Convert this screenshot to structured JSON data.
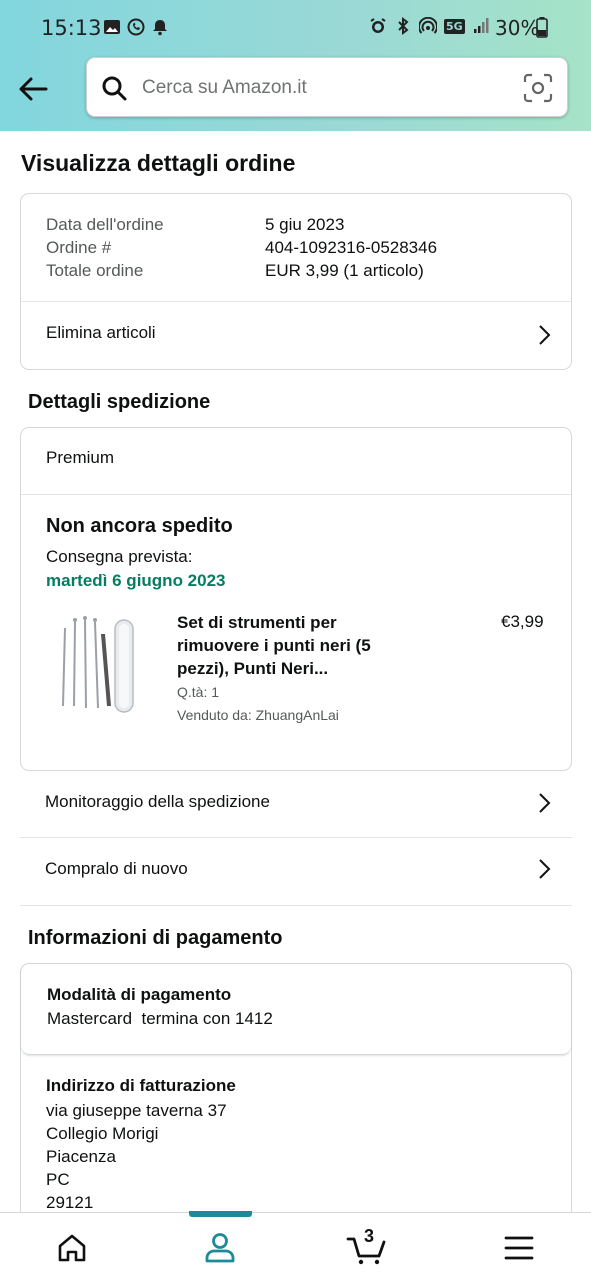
{
  "status_bar": {
    "time": "15:13",
    "battery": "30%",
    "network": "5G"
  },
  "search": {
    "placeholder": "Cerca su Amazon.it"
  },
  "page_title": "Visualizza dettagli ordine",
  "order_summary": {
    "rows": [
      {
        "label": "Data dell'ordine",
        "value": "5 giu 2023"
      },
      {
        "label": "Ordine #",
        "value": "404-1092316-0528346"
      },
      {
        "label": "Totale ordine",
        "value": "EUR 3,99 (1 articolo)"
      }
    ],
    "delete_items": "Elimina articoli"
  },
  "shipping": {
    "section_title": "Dettagli spedizione",
    "service": "Premium",
    "status": "Non ancora spedito",
    "delivery_label": "Consegna prevista:",
    "delivery_date": "martedì 6 giugno 2023",
    "item": {
      "title_line1": "Set di strumenti per",
      "title_line2": "rimuovere i punti neri (5",
      "title_line3": "pezzi), Punti Neri...",
      "price": "€3,99",
      "qty": "Q.tà: 1",
      "seller": "Venduto da: ZhuangAnLai"
    },
    "track": "Monitoraggio della spedizione",
    "buy_again": "Compralo di nuovo"
  },
  "payment": {
    "section_title": "Informazioni di pagamento",
    "method_title": "Modalità di pagamento",
    "method_value": "Mastercard  termina con 1412",
    "billing_title": "Indirizzo di fatturazione",
    "billing_lines": [
      "via giuseppe taverna 37",
      "Collegio Morigi",
      "Piacenza",
      "PC",
      "29121"
    ]
  },
  "bottom_nav": {
    "cart_count": "3"
  },
  "colors": {
    "accent": "#1d8a99",
    "green": "#067d62",
    "header_start": "#82d6de",
    "header_end": "#a6e3c8"
  }
}
